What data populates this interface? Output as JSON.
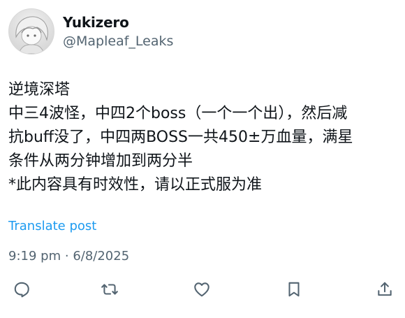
{
  "author": {
    "display_name": "Yukizero",
    "handle": "@Mapleaf_Leaks"
  },
  "post": {
    "lines": [
      "逆境深塔",
      "中三4波怪，中四2个boss（一个一个出），然后减",
      "抗buff没了，中四两BOSS一共450±万血量，满星",
      "条件从两分钟增加到两分半",
      "*此内容具有时效性，请以正式服为准"
    ],
    "translate_label": "Translate post",
    "time": "9:19 pm",
    "separator": "·",
    "date": "6/8/2025"
  },
  "actions": [
    "reply-icon",
    "repost-icon",
    "like-icon",
    "bookmark-icon",
    "share-icon"
  ],
  "colors": {
    "link": "#1d9bf0",
    "secondary": "#536471",
    "text": "#0f1419"
  }
}
